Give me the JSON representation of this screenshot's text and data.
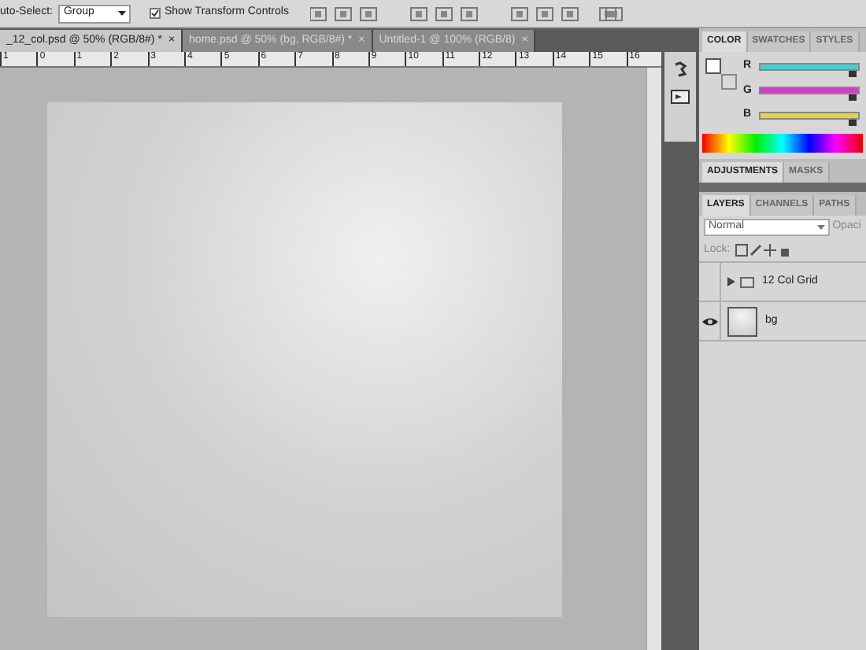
{
  "options_bar": {
    "auto_select_label": "uto-Select:",
    "auto_select_value": "Group",
    "transform_controls": {
      "label": "Show Transform Controls",
      "checked": true
    }
  },
  "document_tabs": [
    {
      "title": "_12_col.psd @ 50% (RGB/8#) *",
      "close": "×",
      "selected": true
    },
    {
      "title": "home.psd @ 50% (bg, RGB/8#) *",
      "close": "×",
      "selected": false
    },
    {
      "title": "Untitled-1 @ 100% (RGB/8)",
      "close": "×",
      "selected": false
    }
  ],
  "ruler_labels": [
    "1",
    "0",
    "1",
    "2",
    "3",
    "4",
    "5",
    "6",
    "7",
    "8",
    "9",
    "10",
    "11",
    "12",
    "13",
    "14",
    "15",
    "16"
  ],
  "color_panel": {
    "tabs": [
      {
        "label": "COLOR",
        "selected": true
      },
      {
        "label": "SWATCHES",
        "selected": false
      },
      {
        "label": "STYLES",
        "selected": false
      }
    ],
    "channels": [
      {
        "name": "R",
        "level": 0.95,
        "color": "#40d0d8"
      },
      {
        "name": "G",
        "level": 0.95,
        "color": "#d040c8"
      },
      {
        "name": "B",
        "level": 0.95,
        "color": "#e0d840"
      }
    ]
  },
  "adjustments_panel": {
    "tabs": [
      {
        "label": "ADJUSTMENTS",
        "selected": true
      },
      {
        "label": "MASKS",
        "selected": false
      }
    ]
  },
  "layers_panel": {
    "tabs": [
      {
        "label": "LAYERS",
        "selected": true
      },
      {
        "label": "CHANNELS",
        "selected": false
      },
      {
        "label": "PATHS",
        "selected": false
      }
    ],
    "blend_mode": "Normal",
    "opacity_label": "Opaci",
    "lock_label": "Lock:",
    "layers": [
      {
        "name": "12 Col Grid",
        "kind": "group",
        "visible": false
      },
      {
        "name": "bg",
        "kind": "pixel",
        "visible": true
      }
    ]
  }
}
